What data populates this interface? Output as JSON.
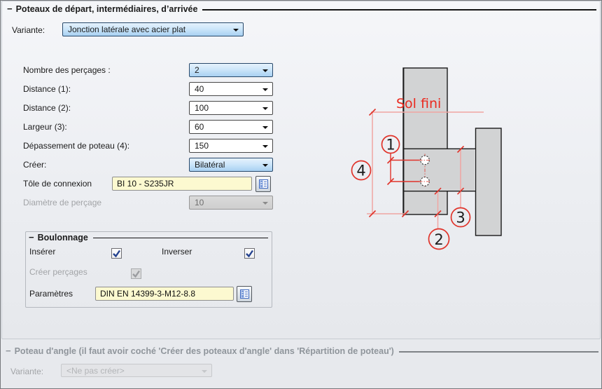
{
  "main_group": {
    "collapse_glyph": "−",
    "title": "Poteaux de départ, intermédiaires, d’arrivée",
    "variante": {
      "label": "Variante:",
      "value": "Jonction latérale avec acier plat"
    },
    "fields": [
      {
        "label": "Nombre des perçages :",
        "value": "2"
      },
      {
        "label": "Distance (1):",
        "value": "40"
      },
      {
        "label": "Distance (2):",
        "value": "100"
      },
      {
        "label": "Largeur (3):",
        "value": "60"
      },
      {
        "label": "Dépassement de poteau (4):",
        "value": "150"
      },
      {
        "label": "Créer:",
        "value": "Bilatéral"
      }
    ],
    "tole": {
      "label": "Tôle de connexion",
      "value": "BI 10 - S235JR"
    },
    "diametre": {
      "label": "Diamètre de perçage",
      "value": "10"
    }
  },
  "boulonnage": {
    "collapse_glyph": "−",
    "title": "Boulonnage",
    "inserer_label": "Insérer",
    "inverser_label": "Inverser",
    "creer_percages_label": "Créer perçages",
    "parametres": {
      "label": "Paramètres",
      "value": "DIN EN 14399-3-M12-8.8"
    }
  },
  "diagram": {
    "sol_fini_label": "Sol fini",
    "balloons": [
      "1",
      "2",
      "3",
      "4"
    ]
  },
  "corner_group": {
    "collapse_glyph": "−",
    "title": "Poteau d'angle (il faut avoir coché 'Créer des poteaux d'angle' dans 'Répartition de poteau')",
    "variante": {
      "label": "Variante:",
      "value": "<Ne pas créer>"
    }
  },
  "colors": {
    "selected_combo_blue": "#a8d1f2",
    "field_yellow": "#fcf9d0",
    "dimension_red": "#e0332a",
    "dimension_pink": "#f0a5a2",
    "steel_gray": "#d2d3d4",
    "check_blue": "#24428f"
  }
}
